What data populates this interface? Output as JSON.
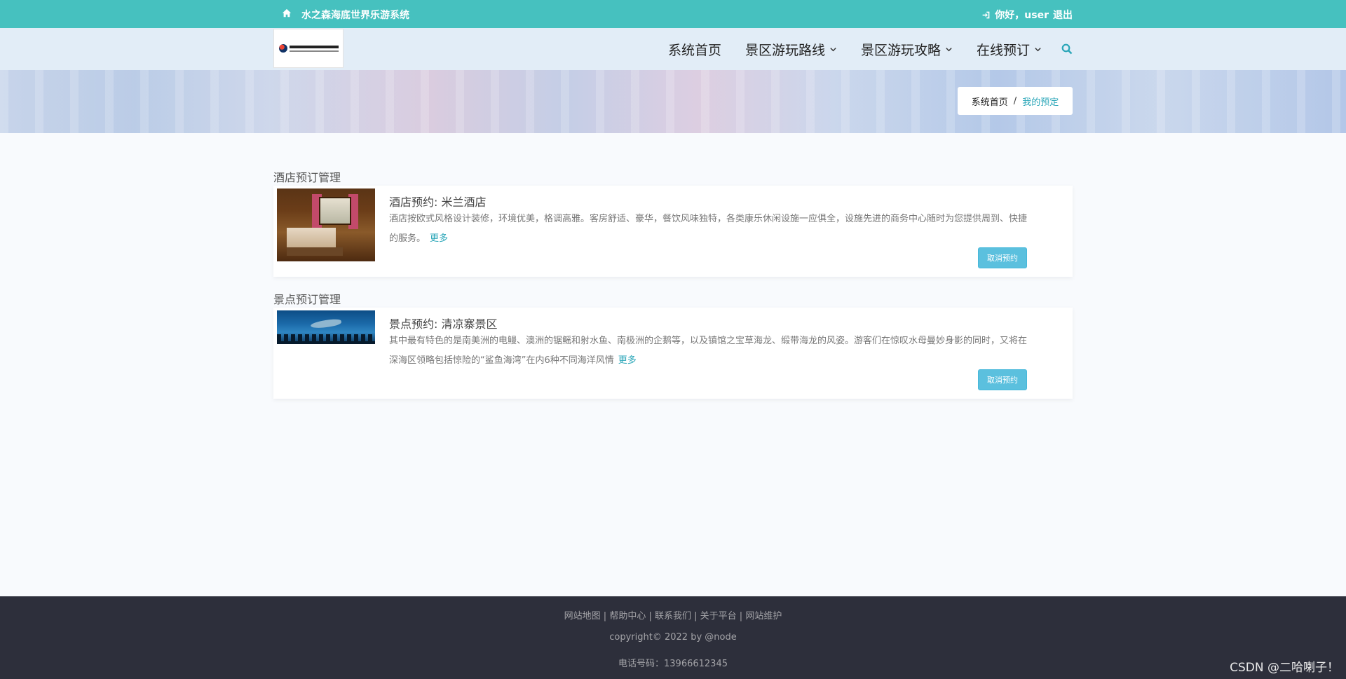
{
  "topbar": {
    "site_name": "水之森海底世界乐游系统",
    "greeting": "你好，user",
    "logout": "退出",
    "bg_color": "#46c1bf",
    "home_icon": "home-icon",
    "login_icon": "sign-in-icon"
  },
  "nav": {
    "items": [
      {
        "label": "系统首页",
        "dropdown": false
      },
      {
        "label": "景区游玩路线",
        "dropdown": true
      },
      {
        "label": "景区游玩攻略",
        "dropdown": true
      },
      {
        "label": "在线预订",
        "dropdown": true
      }
    ],
    "search_icon": "search-icon"
  },
  "breadcrumb": {
    "home": "系统首页",
    "separator": "/",
    "current": "我的预定"
  },
  "sections": [
    {
      "title": "酒店预订管理",
      "item": {
        "title": "酒店预约: 米兰酒店",
        "description": "酒店按欧式风格设计装修，环境优美，格调高雅。客房舒适、豪华，餐饮风味独特，各类康乐休闲设施一应俱全，设施先进的商务中心随时为您提供周到、快捷的服务。",
        "more": "更多",
        "cancel": "取消预约"
      }
    },
    {
      "title": "景点预订管理",
      "item": {
        "title": "景点预约: 清凉寨景区",
        "description": "其中最有特色的是南美洲的电鳗、澳洲的锯鳐和射水鱼、南极洲的企鹅等，以及镇馆之宝草海龙、缎带海龙的风姿。游客们在惊叹水母曼妙身影的同时，又将在深海区领略包括惊险的“鲨鱼海湾”在内6种不同海洋风情",
        "more": "更多",
        "cancel": "取消预约"
      }
    }
  ],
  "footer": {
    "links": [
      "网站地图",
      "帮助中心",
      "联系我们",
      "关于平台",
      "网站维护"
    ],
    "copyright": "copyright© 2022 by @node",
    "phone": "电话号码：13966612345"
  },
  "watermark": "CSDN @二哈喇子！",
  "colors": {
    "accent": "#2aa6b8",
    "button": "#5bc0de",
    "footer_bg": "#2d2f3b"
  }
}
